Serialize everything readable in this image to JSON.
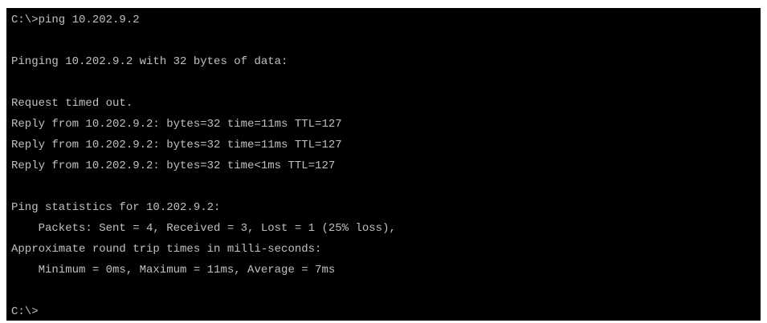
{
  "console": {
    "command_line": "C:\\>ping 10.202.9.2",
    "pinging_line": "Pinging 10.202.9.2 with 32 bytes of data:",
    "replies": [
      "Request timed out.",
      "Reply from 10.202.9.2: bytes=32 time=11ms TTL=127",
      "Reply from 10.202.9.2: bytes=32 time=11ms TTL=127",
      "Reply from 10.202.9.2: bytes=32 time<1ms TTL=127"
    ],
    "stats_header": "Ping statistics for 10.202.9.2:",
    "packets_line": "    Packets: Sent = 4, Received = 3, Lost = 1 (25% loss),",
    "rtt_header": "Approximate round trip times in milli-seconds:",
    "rtt_line": "    Minimum = 0ms, Maximum = 11ms, Average = 7ms",
    "prompt": "C:\\>"
  },
  "colors": {
    "background": "#000000",
    "text": "#c0c0c0"
  }
}
